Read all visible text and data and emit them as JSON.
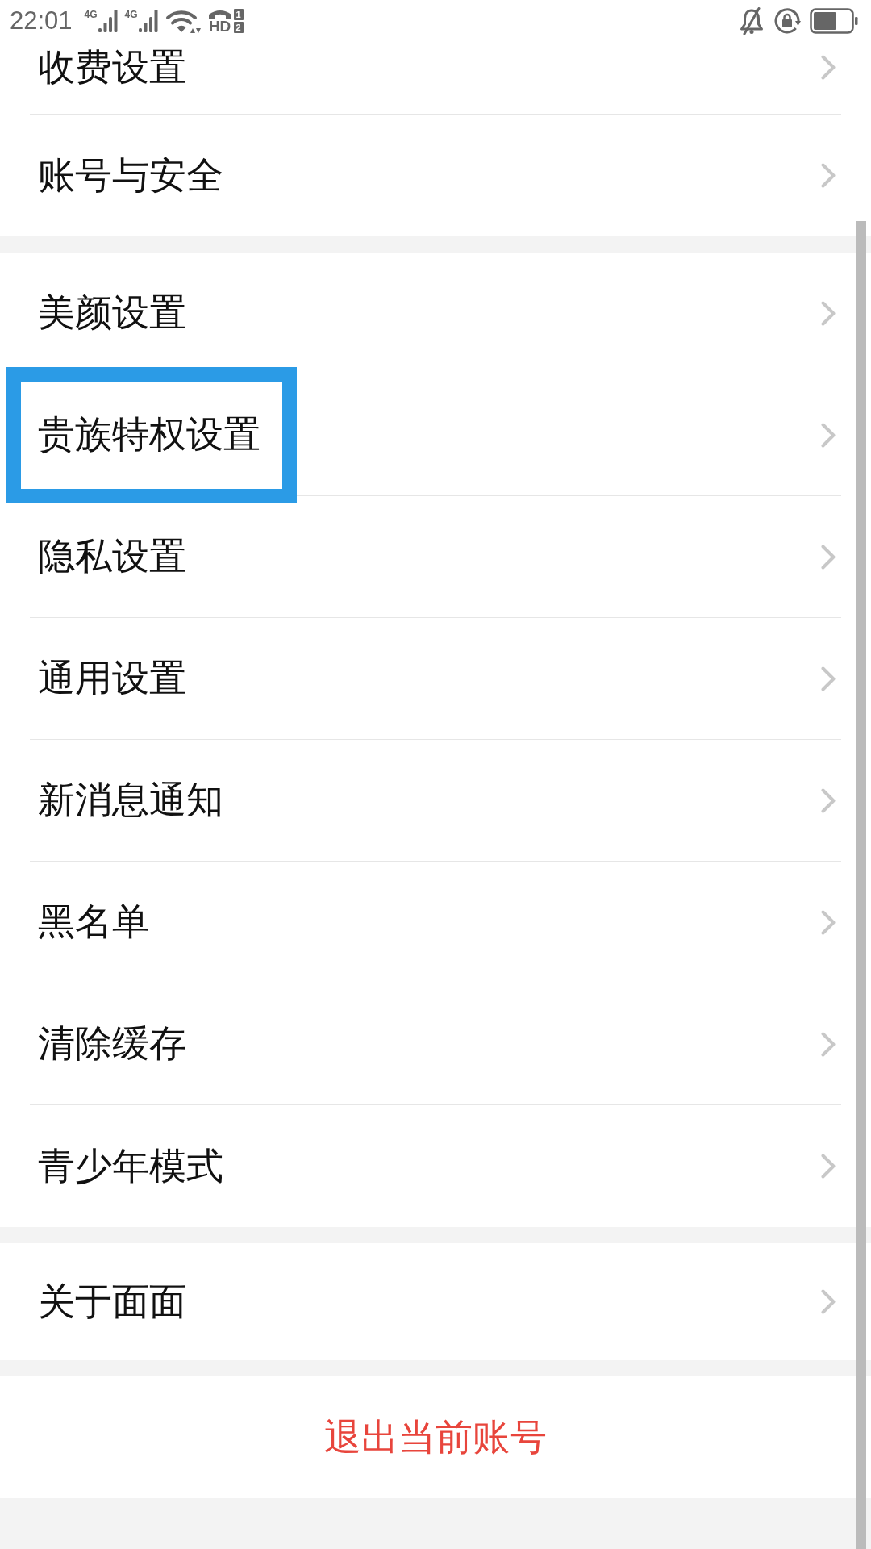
{
  "status_bar": {
    "time": "22:01",
    "sims": [
      {
        "network": "4G"
      },
      {
        "network": "4G"
      }
    ],
    "hd": {
      "label": "HD",
      "slots": [
        "1",
        "2"
      ]
    }
  },
  "groups": [
    {
      "items": [
        {
          "label": "收费设置",
          "highlighted": false
        },
        {
          "label": "账号与安全",
          "highlighted": false
        }
      ]
    },
    {
      "items": [
        {
          "label": "美颜设置",
          "highlighted": false
        },
        {
          "label": "贵族特权设置",
          "highlighted": true
        },
        {
          "label": "隐私设置",
          "highlighted": false
        },
        {
          "label": "通用设置",
          "highlighted": false
        },
        {
          "label": "新消息通知",
          "highlighted": false
        },
        {
          "label": "黑名单",
          "highlighted": false
        },
        {
          "label": "清除缓存",
          "highlighted": false
        },
        {
          "label": "青少年模式",
          "highlighted": false
        }
      ]
    },
    {
      "items": [
        {
          "label": "关于面面",
          "highlighted": false
        }
      ]
    }
  ],
  "logout": {
    "label": "退出当前账号"
  }
}
